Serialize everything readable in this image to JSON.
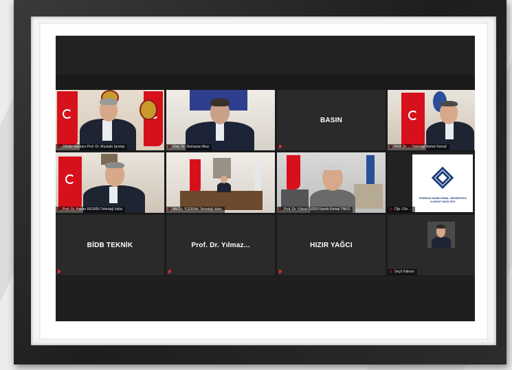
{
  "meeting": {
    "tiles": [
      {
        "name": "",
        "caption": "TBMM Başkanı Prof. Dr. Mustafa Şentop",
        "kind": "video",
        "active": true
      },
      {
        "name": "",
        "caption": "Doç. Dr. Ramazan Akar",
        "kind": "video",
        "active": false
      },
      {
        "name": "BASIN",
        "caption": "",
        "kind": "name",
        "active": false
      },
      {
        "name": "",
        "caption": "Prof. Dr. ... Tekirdağ Namık Kemal",
        "kind": "video",
        "active": false
      },
      {
        "name": "",
        "caption": "Prof. Dr. Hasan KESKİN Tekirdağ Valisi",
        "kind": "video",
        "active": false
      },
      {
        "name": "",
        "caption": "Av. Dr. YÜZIRAK Tekirdağ Valisi",
        "kind": "video",
        "active": false
      },
      {
        "name": "",
        "caption": "Prof. Dr. Yüksel ÖZER Namık Kemal TNKÜ",
        "kind": "video",
        "active": false
      },
      {
        "name": "",
        "caption": "Öğr. Gör. ...",
        "kind": "logo",
        "active": false,
        "logo_text": "TEKİRDAĞ NAMIK KEMAL ÜNİVERSİTESİ İLAHİYAT FAKÜLTESİ"
      },
      {
        "name": "BİDB TEKNİK",
        "caption": "",
        "kind": "name",
        "active": false
      },
      {
        "name": "Prof. Dr. Yılmaz...",
        "caption": "",
        "kind": "name",
        "active": false
      },
      {
        "name": "HIZIR YAĞCI",
        "caption": "",
        "kind": "name",
        "active": false
      },
      {
        "name": "",
        "caption": "Seçil Yalman",
        "kind": "thumb",
        "active": false
      }
    ]
  },
  "colors": {
    "active_border": "#c8d22a",
    "muted_mic": "#e03030",
    "flag_red": "#d6111c",
    "tile_bg": "#2a2a2a"
  },
  "icons": {
    "muted": "mic-muted-icon"
  }
}
